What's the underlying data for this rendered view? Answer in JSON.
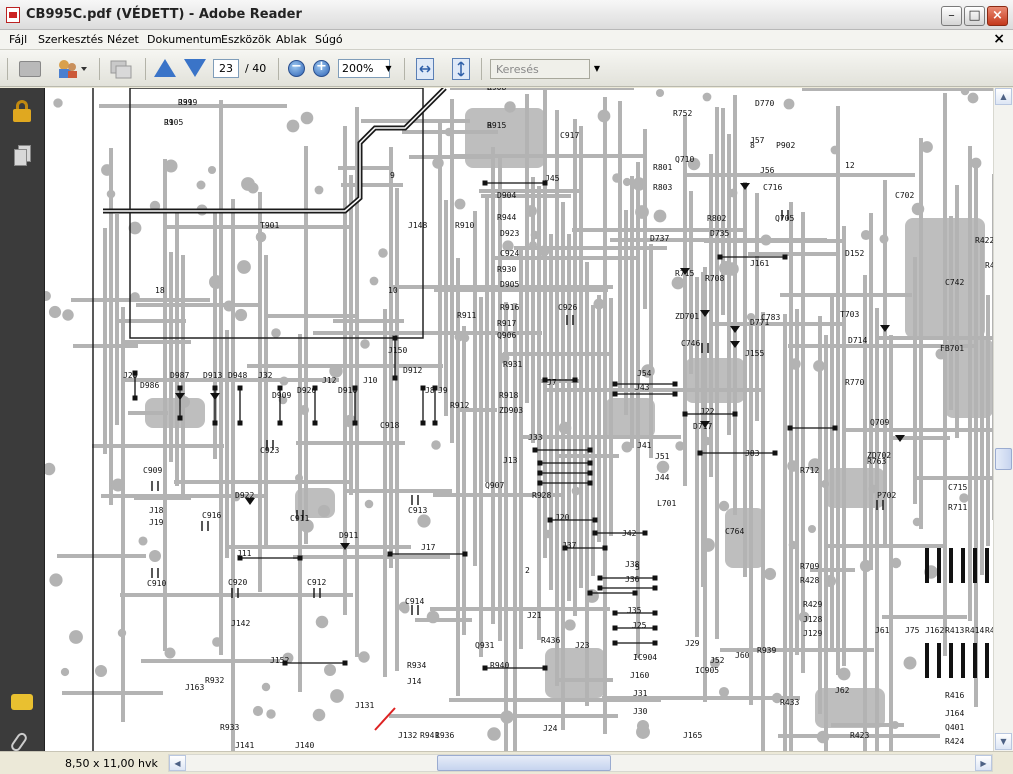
{
  "window": {
    "title": "CB995C.pdf (VÉDETT) - Adobe Reader",
    "min_symbol": "–",
    "max_symbol": "□",
    "close_symbol": "×"
  },
  "menu": {
    "items": [
      "Fájl",
      "Szerkesztés",
      "Nézet",
      "Dokumentum",
      "Eszközök",
      "Ablak",
      "Súgó"
    ],
    "close_symbol": "×"
  },
  "toolbar": {
    "current_page": "23",
    "total_pages": "/ 40",
    "zoom": "200%",
    "search_placeholder": "Keresés",
    "zoom_out_symbol": "−",
    "zoom_in_symbol": "+",
    "dropdown_symbol": "▼",
    "icons": [
      "printer-icon",
      "people-icon",
      "collaborate-icon",
      "previous-page-icon",
      "next-page-icon",
      "zoom-out-icon",
      "zoom-in-icon",
      "fit-width-icon",
      "fit-page-icon"
    ]
  },
  "left_nav": {
    "icons": [
      "lock-icon",
      "pages-icon",
      "comment-icon",
      "attachment-icon"
    ]
  },
  "document": {
    "labels": [
      "R919",
      "R905",
      "R908",
      "R915",
      "C917",
      "J45",
      "D904",
      "R944",
      "R910",
      "D923",
      "C924",
      "R930",
      "D905",
      "R916",
      "R917",
      "Q906",
      "R931",
      "J148",
      "T901",
      "18",
      "10",
      "9",
      "C926",
      "R911",
      "J7",
      "R918",
      "ZD903",
      "R912",
      "J28",
      "D986",
      "D987",
      "D913",
      "D948",
      "J32",
      "D909",
      "D920",
      "J12",
      "D910",
      "J10",
      "J150",
      "D912",
      "J8",
      "J9",
      "C918",
      "C923",
      "J33",
      "J13",
      "Q907",
      "R928",
      "C909",
      "J18",
      "J19",
      "C910",
      "C916",
      "D922",
      "C911",
      "D911",
      "C913",
      "J11",
      "J17",
      "J20",
      "C920",
      "C912",
      "C914",
      "J37",
      "J38",
      "J36",
      "J35",
      "J42",
      "J41",
      "J51",
      "J44",
      "J54",
      "J43",
      "J22",
      "D717",
      "J83",
      "R752",
      "Q710",
      "R801",
      "R803",
      "R802",
      "D737",
      "D735",
      "R715",
      "R708",
      "J161",
      "ZD701",
      "C746",
      "C783",
      "D771",
      "J155",
      "J57",
      "J56",
      "C716",
      "D770",
      "Q705",
      "C702",
      "T703",
      "D714",
      "FB701",
      "R770",
      "Q709",
      "R763",
      "ZD702",
      "R712",
      "L701",
      "C764",
      "P702",
      "C715",
      "R711",
      "R709",
      "R428",
      "R429",
      "J128",
      "J129",
      "J61",
      "J75",
      "J162",
      "R413",
      "R414",
      "R415",
      "R416",
      "J142",
      "J163",
      "R932",
      "R933",
      "J152",
      "R934",
      "J14",
      "J131",
      "J132",
      "R941",
      "R936",
      "J141",
      "J140",
      "Q931",
      "R940",
      "J21",
      "R436",
      "J23",
      "J24",
      "J25",
      "IC904",
      "J160",
      "J31",
      "J30",
      "J165",
      "J29",
      "IC905",
      "J52",
      "J60",
      "R939",
      "R433",
      "J62",
      "J164",
      "Q401",
      "R424",
      "R423",
      "R422",
      "R425",
      "C742",
      "D152",
      "12",
      "2",
      "5",
      "8",
      "P902",
      "J39",
      "J1",
      "E",
      "B"
    ]
  },
  "status": {
    "page_size": "8,50 x 11,00 hvk"
  },
  "colors": {
    "trace": "#b3b3b3",
    "thick_trace": "#1a1a1a",
    "navbar": "#3b3b3b",
    "accent_blue": "#3a74c8"
  }
}
